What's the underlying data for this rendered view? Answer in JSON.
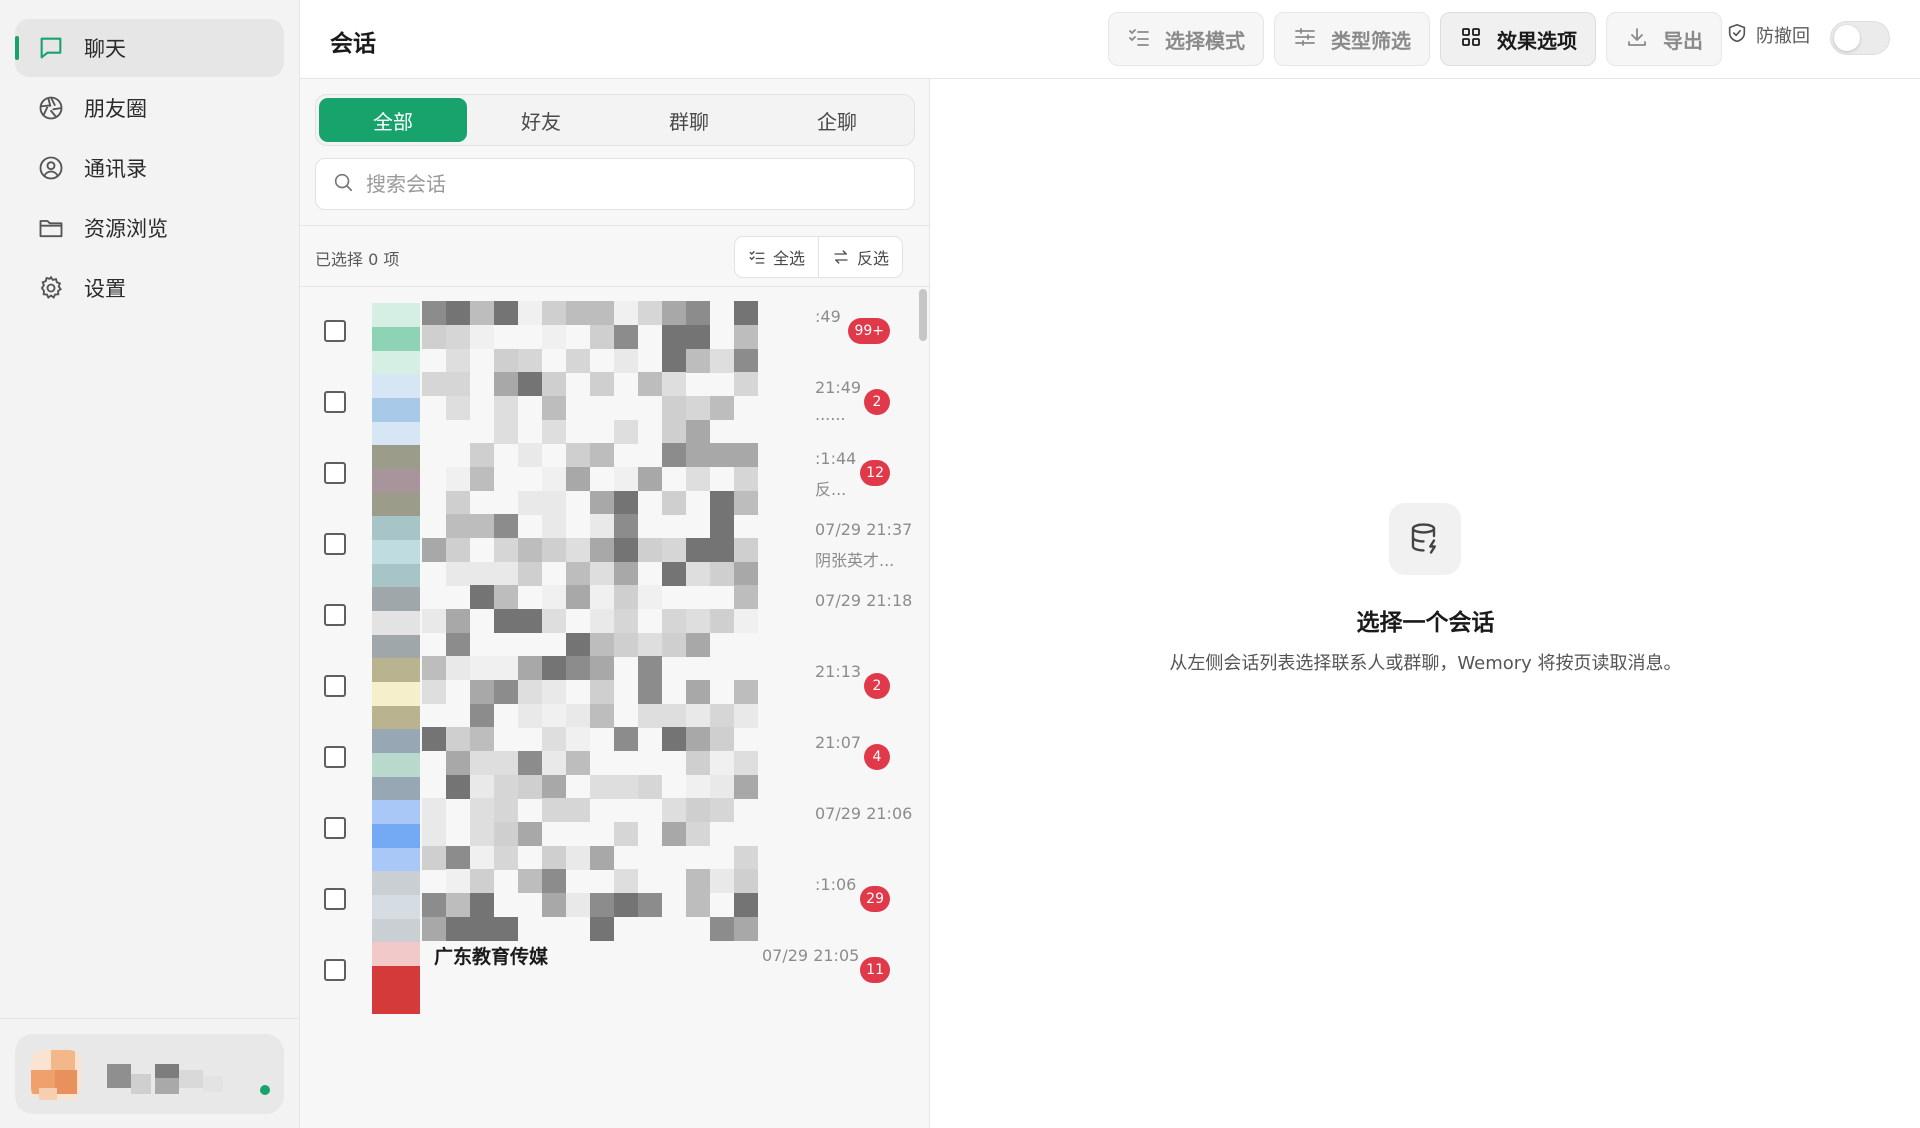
{
  "nav": {
    "items": [
      {
        "label": "聊天",
        "icon": "chat-bubble-icon",
        "active": true
      },
      {
        "label": "朋友圈",
        "icon": "aperture-icon",
        "active": false
      },
      {
        "label": "通讯录",
        "icon": "user-circle-icon",
        "active": false
      },
      {
        "label": "资源浏览",
        "icon": "folder-icon",
        "active": false
      },
      {
        "label": "设置",
        "icon": "gear-icon",
        "active": false
      }
    ]
  },
  "header": {
    "title": "会话",
    "select_mode": "选择模式",
    "type_filter": "类型筛选",
    "effect_options": "效果选项",
    "export": "导出",
    "anti_recall": "防撤回",
    "anti_recall_on": false
  },
  "tabs": [
    "全部",
    "好友",
    "群聊",
    "企聊"
  ],
  "search": {
    "placeholder": "搜索会话"
  },
  "selection": {
    "count_text": "已选择 0 项",
    "select_all": "全选",
    "invert": "反选"
  },
  "conversations": [
    {
      "time": ":49",
      "preview": "",
      "badge": "99+"
    },
    {
      "time": "21:49",
      "preview": "......",
      "badge": "2"
    },
    {
      "time": ":1:44",
      "preview": "反...",
      "badge": "12"
    },
    {
      "time": "07/29 21:37",
      "preview": "阴张英才...",
      "badge": ""
    },
    {
      "time": "07/29 21:18",
      "preview": "",
      "badge": ""
    },
    {
      "time": "21:13",
      "preview": "",
      "badge": "2"
    },
    {
      "time": "21:07",
      "preview": "",
      "badge": "4"
    },
    {
      "time": "07/29 21:06",
      "preview": "",
      "badge": ""
    },
    {
      "time": ":1:06",
      "preview": "",
      "badge": "29"
    },
    {
      "name": "广东教育传媒",
      "time": "07/29 21:05",
      "preview": "",
      "badge": "11"
    }
  ],
  "empty_state": {
    "title": "选择一个会话",
    "description": "从左侧会话列表选择联系人或群聊，Wemory 将按页读取消息。"
  },
  "colors": {
    "accent": "#17a36b",
    "badge": "#e0394a"
  }
}
